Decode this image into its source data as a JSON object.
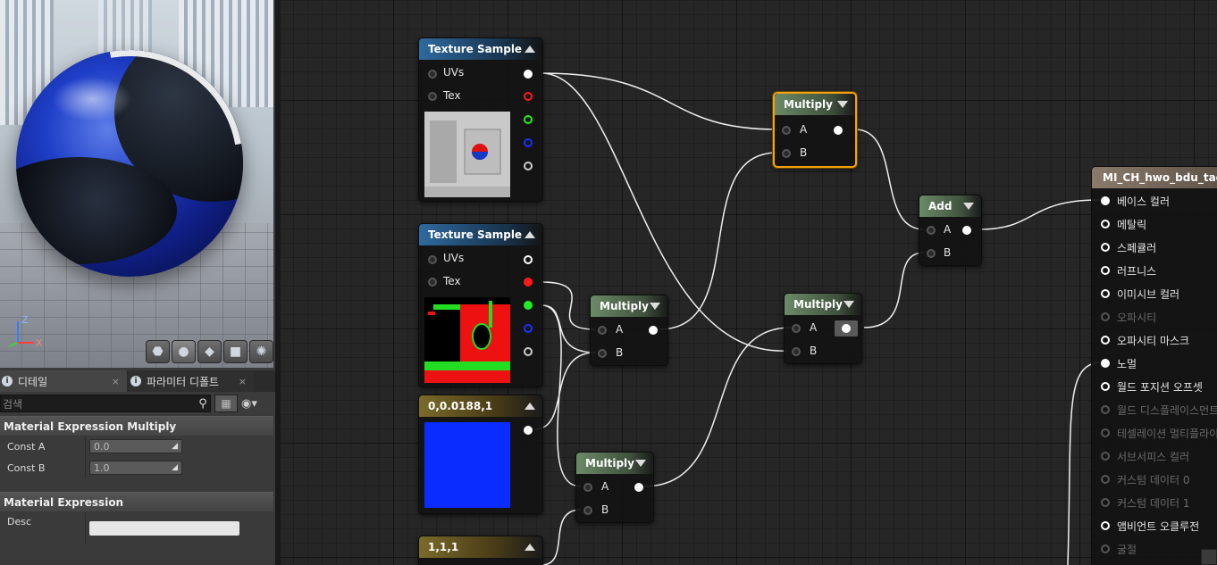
{
  "viewport": {
    "axis_x": "X",
    "axis_z": "Z",
    "preview_buttons": [
      {
        "name": "cylinder-preview-icon",
        "glyph": "⬣"
      },
      {
        "name": "sphere-preview-icon",
        "glyph": "●"
      },
      {
        "name": "plane-preview-icon",
        "glyph": "◆"
      },
      {
        "name": "cube-preview-icon",
        "glyph": "■"
      },
      {
        "name": "custom-mesh-preview-icon",
        "glyph": "✺"
      }
    ]
  },
  "panel": {
    "tabs": [
      {
        "label": "디테일",
        "close": "×"
      },
      {
        "label": "파라미터 디폴트",
        "close": "×"
      }
    ],
    "search_placeholder": "검색",
    "search_icon": "⚲",
    "grid_icon": "▦",
    "eye_icon": "◉▾",
    "categories": [
      {
        "title": "Material Expression Multiply",
        "props": [
          {
            "label": "Const A",
            "value": "0.0"
          },
          {
            "label": "Const B",
            "value": "1.0"
          }
        ]
      },
      {
        "title": "Material Expression",
        "props": [
          {
            "label": "Desc",
            "value": ""
          }
        ]
      }
    ]
  },
  "nodes": {
    "tex1": {
      "title": "Texture Sample",
      "pins": [
        "UVs",
        "Tex"
      ]
    },
    "tex2": {
      "title": "Texture Sample",
      "pins": [
        "UVs",
        "Tex"
      ]
    },
    "const3": {
      "title": "0,0.0188,1"
    },
    "const4": {
      "title": "1,1,1"
    },
    "mul1": {
      "title": "Multiply",
      "a": "A",
      "b": "B"
    },
    "mul2": {
      "title": "Multiply",
      "a": "A",
      "b": "B"
    },
    "mul3": {
      "title": "Multiply",
      "a": "A",
      "b": "B"
    },
    "mul4": {
      "title": "Multiply",
      "a": "A",
      "b": "B"
    },
    "add": {
      "title": "Add",
      "a": "A",
      "b": "B"
    }
  },
  "result": {
    "title": "MI_CH_hwo_bdu_taekw",
    "inputs": [
      {
        "label": "베이스 컬러",
        "active": true,
        "connected": true
      },
      {
        "label": "메탈릭",
        "active": true,
        "connected": false
      },
      {
        "label": "스페큘러",
        "active": true,
        "connected": false
      },
      {
        "label": "러프니스",
        "active": true,
        "connected": false
      },
      {
        "label": "이미시브 컬러",
        "active": true,
        "connected": false
      },
      {
        "label": "오파시티",
        "active": false,
        "connected": false
      },
      {
        "label": "오파시티 마스크",
        "active": true,
        "connected": false
      },
      {
        "label": "노멀",
        "active": true,
        "connected": true
      },
      {
        "label": "월드 포지션 오프셋",
        "active": true,
        "connected": false
      },
      {
        "label": "월드 디스플레이스먼트",
        "active": false,
        "connected": false
      },
      {
        "label": "테셀레이션 멀티플라이어",
        "active": false,
        "connected": false
      },
      {
        "label": "서브서피스 컬러",
        "active": false,
        "connected": false
      },
      {
        "label": "커스텀 데이터 0",
        "active": false,
        "connected": false
      },
      {
        "label": "커스텀 데이터 1",
        "active": false,
        "connected": false
      },
      {
        "label": "앰비언트 오클루전",
        "active": true,
        "connected": false
      },
      {
        "label": "굴절",
        "active": false,
        "connected": false
      }
    ]
  },
  "colors": {
    "selection": "#f2a20c",
    "pin_red": "#ff1a1a",
    "pin_green": "#22ee22",
    "pin_blue": "#1a33ff",
    "const_blue": "#0b2cff"
  }
}
